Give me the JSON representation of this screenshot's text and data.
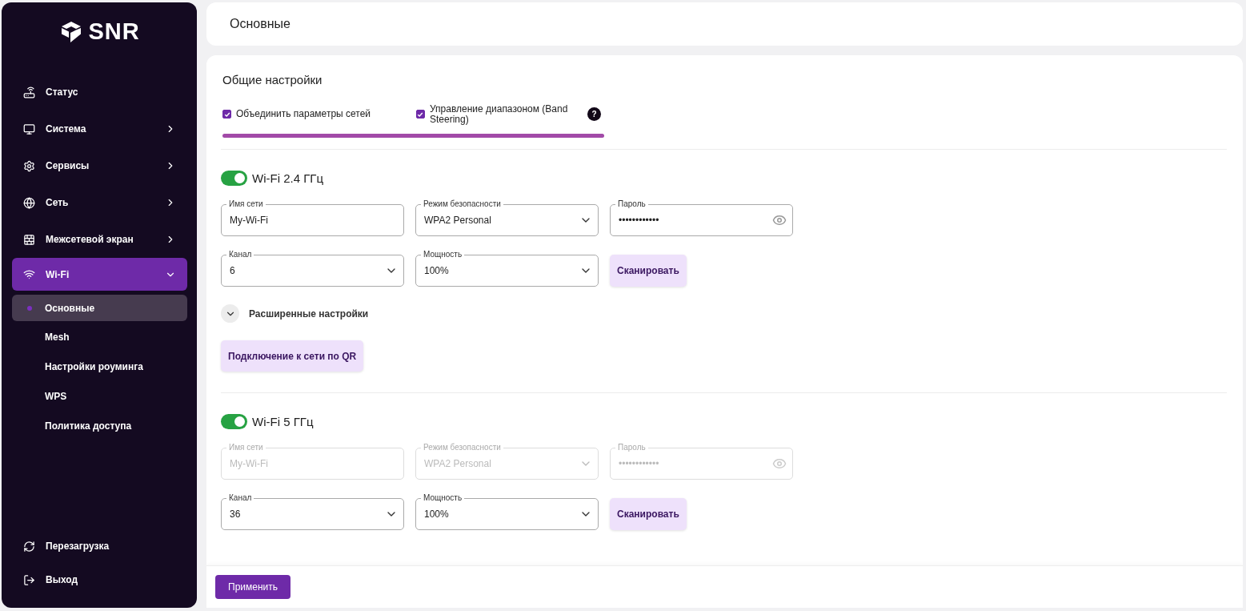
{
  "sidebar": {
    "logo": "SNR",
    "items": [
      {
        "label": "Статус",
        "kind": "link"
      },
      {
        "label": "Система",
        "kind": "group",
        "expanded": false,
        "selected": false
      },
      {
        "label": "Сервисы",
        "kind": "group",
        "expanded": false,
        "selected": false
      },
      {
        "label": "Сеть",
        "kind": "group",
        "expanded": false,
        "selected": false
      },
      {
        "label": "Межсетевой экран",
        "kind": "group",
        "expanded": false,
        "selected": false
      },
      {
        "label": "Wi-Fi",
        "kind": "group",
        "expanded": true,
        "selected": true,
        "children": [
          {
            "label": "Основные",
            "selected": true
          },
          {
            "label": "Mesh",
            "selected": false
          },
          {
            "label": "Настройки роуминга",
            "selected": false
          },
          {
            "label": "WPS",
            "selected": false
          },
          {
            "label": "Политика доступа",
            "selected": false
          }
        ]
      }
    ],
    "footer_items": [
      {
        "label": "Перезагрузка"
      },
      {
        "label": "Выход"
      }
    ]
  },
  "header": {
    "title": "Основные"
  },
  "general": {
    "title": "Общие настройки",
    "options": [
      {
        "label": "Объединить параметры сетей",
        "checked": true
      },
      {
        "label": "Управление диапазоном (Band Steering)",
        "checked": true,
        "help": "?"
      }
    ]
  },
  "bands": [
    {
      "title": "Wi-Fi 2.4 ГГц",
      "enabled": true,
      "fields": [
        {
          "kind": "text",
          "label": "Имя сети",
          "value": "My-Wi-Fi",
          "disabled": false
        },
        {
          "kind": "select",
          "label": "Режим безопасности",
          "value": "WPA2 Personal",
          "disabled": false
        },
        {
          "kind": "password",
          "label": "Пароль",
          "value": "••••••••••••",
          "disabled": false
        },
        {
          "kind": "select",
          "label": "Канал",
          "value": "6",
          "disabled": false
        },
        {
          "kind": "select",
          "label": "Мощность",
          "value": "100%",
          "disabled": false
        },
        {
          "kind": "button",
          "label": "Сканировать"
        }
      ],
      "advanced": {
        "label": "Расширенные настройки",
        "expanded": false
      },
      "qr_button": "Подключение к сети по QR"
    },
    {
      "title": "Wi-Fi 5 ГГц",
      "enabled": true,
      "fields": [
        {
          "kind": "text",
          "label": "Имя сети",
          "value": "My-Wi-Fi",
          "disabled": true
        },
        {
          "kind": "select",
          "label": "Режим безопасности",
          "value": "WPA2 Personal",
          "disabled": true
        },
        {
          "kind": "password",
          "label": "Пароль",
          "value": "••••••••••••",
          "disabled": true
        },
        {
          "kind": "select",
          "label": "Канал",
          "value": "36",
          "disabled": false
        },
        {
          "kind": "select",
          "label": "Мощность",
          "value": "100%",
          "disabled": false
        },
        {
          "kind": "button",
          "label": "Сканировать"
        }
      ]
    }
  ],
  "footer": {
    "apply_button": "Применить"
  }
}
